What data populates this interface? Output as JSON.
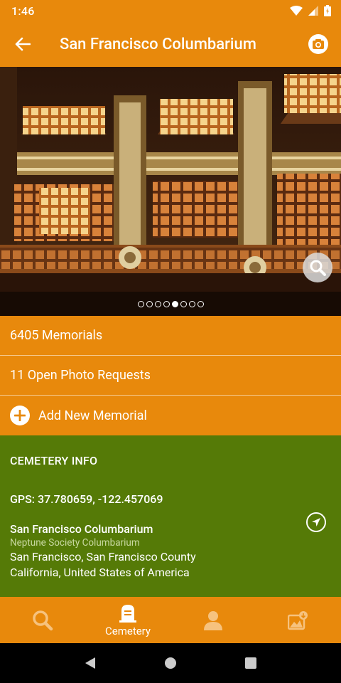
{
  "status_bar": {
    "time": "1:46"
  },
  "app_bar": {
    "title": "San Francisco Columbarium"
  },
  "gallery": {
    "total_photos": 8,
    "active_index": 4
  },
  "rows": {
    "memorials": "6405 Memorials",
    "photo_requests": "11 Open Photo Requests",
    "add_memorial": "Add New Memorial"
  },
  "cemetery_info": {
    "header": "CEMETERY INFO",
    "gps": "GPS: 37.780659, -122.457069",
    "name": "San Francisco Columbarium",
    "alt_name": "Neptune Society Columbarium",
    "city_line": "San Francisco, San Francisco County",
    "state_line": "California, United States of America"
  },
  "bottom_nav": {
    "active_label": "Cemetery"
  },
  "icons": {
    "back": "arrow-left-icon",
    "camera": "camera-icon",
    "zoom": "magnifier-icon",
    "add": "plus-circle-icon",
    "navigate": "navigation-arrow-icon",
    "search": "search-icon",
    "cemetery": "headstone-icon",
    "profile": "person-icon",
    "photos": "photo-request-icon"
  },
  "colors": {
    "primary": "#E8890C",
    "info_bg": "#557A07",
    "inactive_icon": "#F6C27E"
  }
}
